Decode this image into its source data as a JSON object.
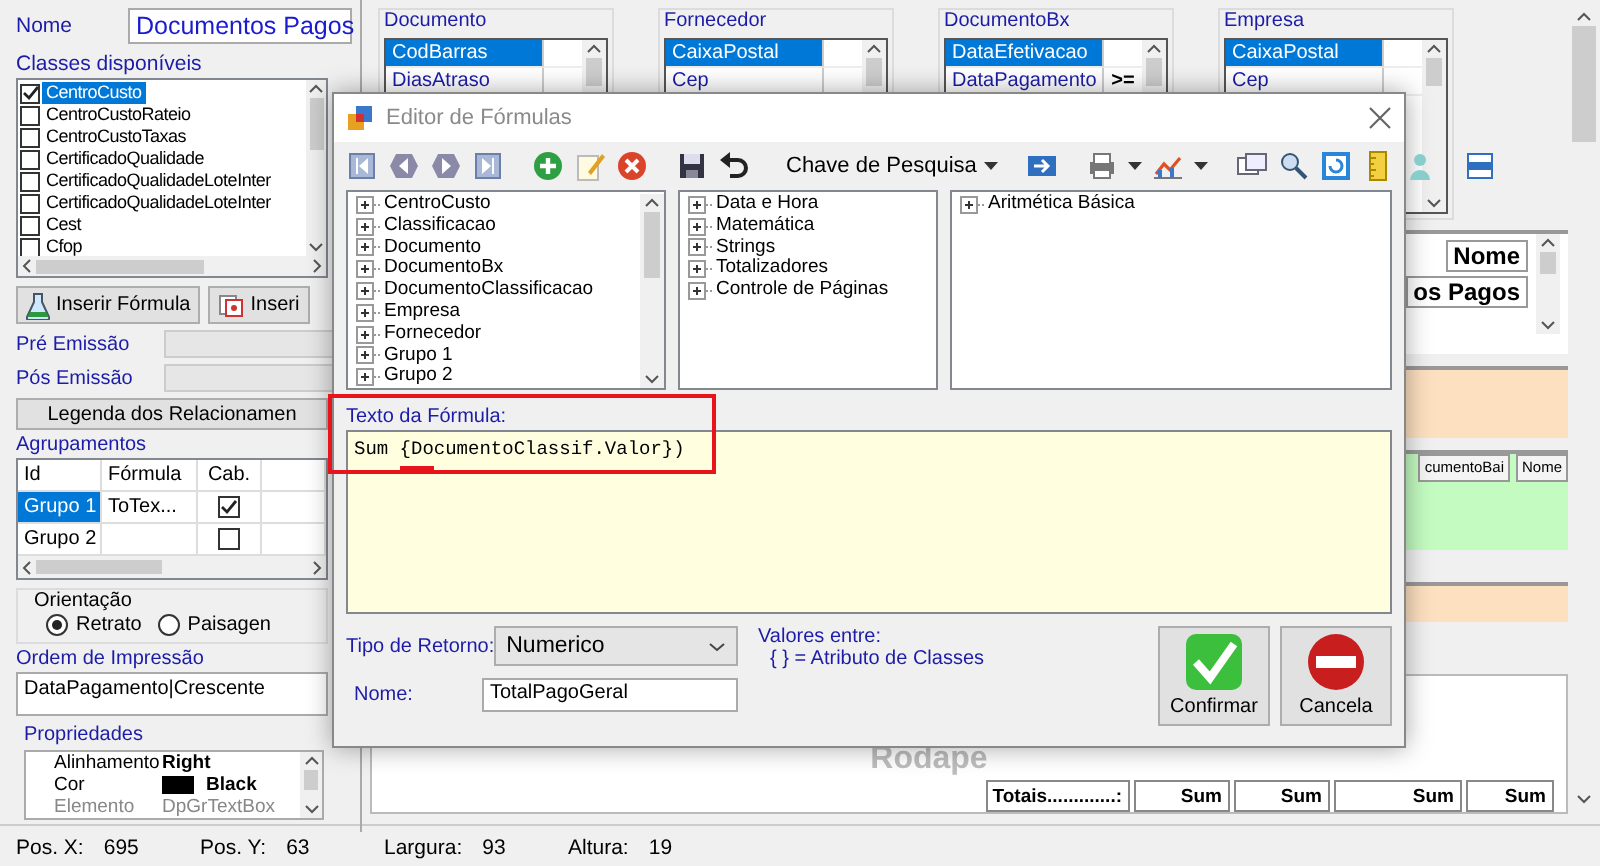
{
  "left_panel": {
    "name_label": "Nome",
    "name_value": "Documentos Pagos",
    "classes_label": "Classes disponíveis",
    "classes": [
      {
        "label": "CentroCusto",
        "checked": true,
        "selected": true
      },
      {
        "label": "CentroCustoRateio",
        "checked": false,
        "selected": false
      },
      {
        "label": "CentroCustoTaxas",
        "checked": false,
        "selected": false
      },
      {
        "label": "CertificadoQualidade",
        "checked": false,
        "selected": false
      },
      {
        "label": "CertificadoQualidadeLoteInter",
        "checked": false,
        "selected": false
      },
      {
        "label": "CertificadoQualidadeLoteInter",
        "checked": false,
        "selected": false
      },
      {
        "label": "Cest",
        "checked": false,
        "selected": false
      },
      {
        "label": "Cfop",
        "checked": false,
        "selected": false
      }
    ],
    "buttons": [
      {
        "label": "Inserir Fórmula",
        "kind": "flask"
      },
      {
        "label": "Inseri",
        "kind": "cards"
      }
    ],
    "pre_emission_label": "Pré Emissão",
    "post_emission_label": "Pós Emissão",
    "legend_button": "Legenda dos Relacionamen",
    "groups": {
      "label": "Agrupamentos",
      "columns": [
        "Id",
        "Fórmula",
        "Cab."
      ],
      "rows": [
        {
          "id": "Grupo 1",
          "formula": "ToTex...",
          "header": true,
          "selected": true
        },
        {
          "id": "Grupo 2",
          "header": false,
          "selected": false
        }
      ]
    },
    "orientation": {
      "label": "Orientação",
      "options": [
        {
          "label": "Retrato",
          "selected": true
        },
        {
          "label": "Paisagen",
          "selected": false
        }
      ]
    },
    "print_order": {
      "label": "Ordem de Impressão",
      "value": "DataPagamento|Crescente"
    },
    "properties": {
      "label": "Propriedades",
      "rows": [
        {
          "name": "Alinhamento",
          "value": "Right",
          "kind": "text",
          "disabled": false
        },
        {
          "name": "Cor",
          "value": "Black",
          "kind": "color",
          "color": "#000000",
          "disabled": false
        },
        {
          "name": "Elemento",
          "value": "DpGrTextBox",
          "kind": "text",
          "disabled": true
        }
      ]
    }
  },
  "class_boxes": [
    {
      "title": "Documento",
      "fields": [
        {
          "name": "CodBarras",
          "selected": true
        },
        {
          "name": "DiasAtraso",
          "selected": false
        }
      ]
    },
    {
      "title": "Fornecedor",
      "fields": [
        {
          "name": "CaixaPostal",
          "selected": true
        },
        {
          "name": "Cep",
          "selected": false
        }
      ]
    },
    {
      "title": "DocumentoBx",
      "fields": [
        {
          "name": "DataEfetivacao",
          "selected": true
        },
        {
          "name": "DataPagamento",
          "selected": false,
          "operator": ">="
        }
      ]
    },
    {
      "title": "Empresa",
      "fields": [
        {
          "name": "CaixaPostal",
          "selected": true
        },
        {
          "name": "Cep",
          "selected": false
        }
      ]
    }
  ],
  "report": {
    "header_cells": [
      "Nome",
      "os Pagos"
    ],
    "detail_headers": [
      "cumentoBai",
      "Nome"
    ],
    "footer": {
      "title": "Rodape",
      "totals_label": "Totais.............:",
      "sums": [
        "Sum",
        "Sum",
        "Sum",
        "Sum"
      ]
    }
  },
  "status_bar": [
    {
      "label": "Pos. X:",
      "value": "695"
    },
    {
      "label": "Pos. Y:",
      "value": "63"
    },
    {
      "label": "Largura:",
      "value": "93"
    },
    {
      "label": "Altura:",
      "value": "19"
    }
  ],
  "dialog": {
    "title": "Editor de Fórmulas",
    "search_key": "Chave de Pesquisa",
    "trees": [
      [
        {
          "label": "CentroCusto",
          "expanded": false
        },
        {
          "label": "Classificacao",
          "expanded": false
        },
        {
          "label": "Documento",
          "expanded": false
        },
        {
          "label": "DocumentoBx",
          "expanded": false
        },
        {
          "label": "DocumentoClassificacao",
          "expanded": false
        },
        {
          "label": "Empresa",
          "expanded": false
        },
        {
          "label": "Fornecedor",
          "expanded": false
        },
        {
          "label": "Grupo 1",
          "expanded": false
        },
        {
          "label": "Grupo 2",
          "expanded": false
        }
      ],
      [
        {
          "label": "Data e Hora",
          "expanded": false
        },
        {
          "label": "Matemática",
          "expanded": false
        },
        {
          "label": "Strings",
          "expanded": false
        },
        {
          "label": "Totalizadores",
          "expanded": false
        },
        {
          "label": "Controle de Páginas",
          "expanded": false
        }
      ],
      [
        {
          "label": "Aritmética Básica",
          "expanded": false
        }
      ]
    ],
    "formula_label": "Texto da Fórmula:",
    "formula": "Sum {DocumentoClassif.Valor})",
    "return_type_label": "Tipo de Retorno:",
    "return_type": "Numerico",
    "values_label": "Valores entre:",
    "values_hint": "{ } = Atributo de Classes",
    "name_label": "Nome:",
    "name_value": "TotalPagoGeral",
    "confirm": "Confirmar",
    "cancel": "Cancela"
  }
}
